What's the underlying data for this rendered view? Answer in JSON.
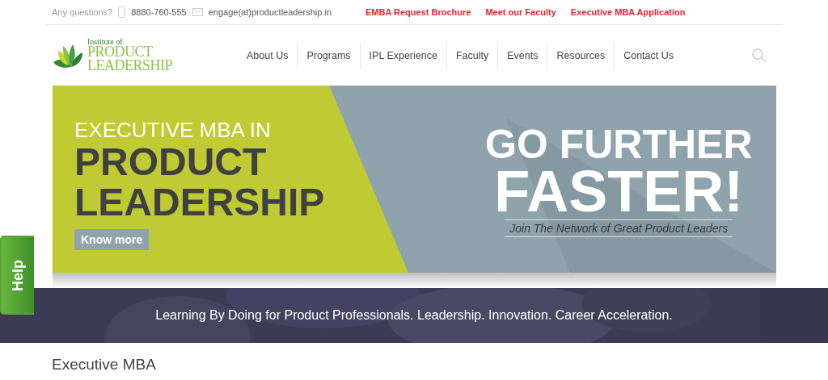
{
  "top_bar": {
    "question": "Any questions?",
    "phone": "8880-760-555",
    "email": "engage(at)productleadership.in",
    "links": [
      "EMBA Request Brochure",
      "Meet our Faculty",
      "Executive MBA Application"
    ]
  },
  "logo": {
    "line_1": "Institute of",
    "line_2": "PRODUCT",
    "line_3": "LEADERSHIP"
  },
  "nav": [
    "About Us",
    "Programs",
    "IPL Experience",
    "Faculty",
    "Events",
    "Resources",
    "Contact Us"
  ],
  "banner": {
    "subtitle": "EXECUTIVE MBA IN",
    "title_1": "PRODUCT",
    "title_2": "LEADERSHIP",
    "button": "Know more",
    "headline_1": "GO FURTHER",
    "headline_2": "FASTER!",
    "tagline": "Join The Network of Great Product Leaders"
  },
  "strip": {
    "text": "Learning By Doing for Product Professionals. Leadership. Innovation. Career Acceleration."
  },
  "section_title": "Executive MBA",
  "help_tab": "Help"
}
